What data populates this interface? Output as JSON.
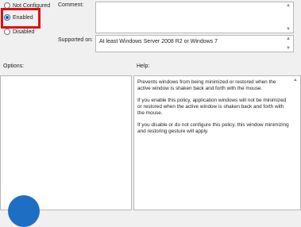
{
  "state_options": {
    "not_configured": "Not Configured",
    "enabled": "Enabled",
    "disabled": "Disabled",
    "selected": "Enabled"
  },
  "comment": {
    "label": "Comment:",
    "value": ""
  },
  "supported_on": {
    "label": "Supported on:",
    "value": "At least Windows Server 2008 R2 or Windows 7"
  },
  "options": {
    "label": "Options:"
  },
  "help": {
    "label": "Help:",
    "paragraphs": [
      "Prevents windows from being minimized or restored when the active window is shaken back and forth with the mouse.",
      "If you enable this policy, application windows will not be minimized or restored when the active window is shaken back and forth with the mouse.",
      "If you disable or do not configure this policy, this window minimizing and restoring gesture will apply."
    ]
  },
  "colors": {
    "highlight": "#e01010",
    "accent": "#1a5fb4",
    "icon": "#1e6fc4"
  }
}
